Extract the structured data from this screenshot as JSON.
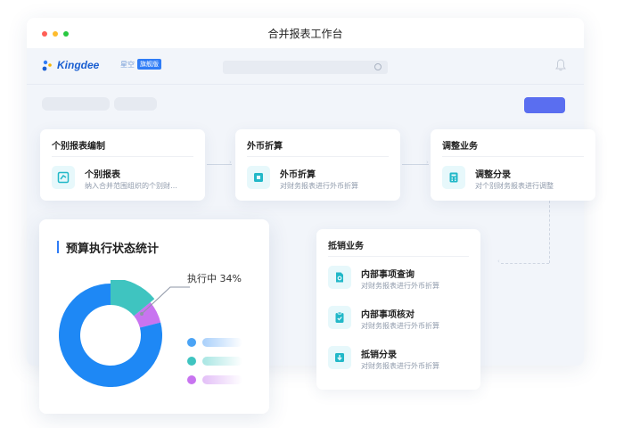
{
  "window": {
    "title": "合并报表工作台"
  },
  "appbar": {
    "brand": "Kingdee",
    "brand_sub": "星空",
    "brand_badge": "旗舰版",
    "search_icon": "search-icon",
    "bell_icon": "bell-icon"
  },
  "colors": {
    "primary": "#5a6ef0",
    "teal": "#3fc4c0",
    "blue": "#1e88f5",
    "purple": "#c874f0",
    "icon_bg": "#e7f8fb",
    "icon_fg": "#22b8c8"
  },
  "workflow": {
    "individual": {
      "header": "个别报表编制",
      "item": {
        "title": "个别报表",
        "desc": "纳入合并范围组织的个别财…",
        "icon": "report-edit-icon"
      }
    },
    "currency": {
      "header": "外币折算",
      "item": {
        "title": "外币折算",
        "desc": "对财务报表进行外币折算",
        "icon": "currency-convert-icon"
      }
    },
    "adjust": {
      "header": "调整业务",
      "item": {
        "title": "调整分录",
        "desc": "对个别财务报表进行调整",
        "icon": "calculator-icon"
      }
    },
    "elimination": {
      "header": "抵销业务",
      "items": [
        {
          "title": "内部事项查询",
          "desc": "对财务报表进行外币折算",
          "icon": "document-search-icon"
        },
        {
          "title": "内部事项核对",
          "desc": "对财务报表进行外币折算",
          "icon": "clipboard-check-icon"
        },
        {
          "title": "抵销分录",
          "desc": "对财务报表进行外币折算",
          "icon": "download-icon"
        }
      ]
    }
  },
  "stats": {
    "title": "预算执行状态统计",
    "callout": "执行中 34%",
    "chart_data": {
      "type": "pie",
      "title": "预算执行状态统计",
      "slices": [
        {
          "label": "执行中",
          "value": 14,
          "color": "#3fc4c0"
        },
        {
          "label": "",
          "value": 7,
          "color": "#c874f0"
        },
        {
          "label": "",
          "value": 79,
          "color": "#1e88f5"
        }
      ],
      "legend_colors": [
        "#4aa3f5",
        "#3fc4c0",
        "#c874f0"
      ]
    }
  }
}
